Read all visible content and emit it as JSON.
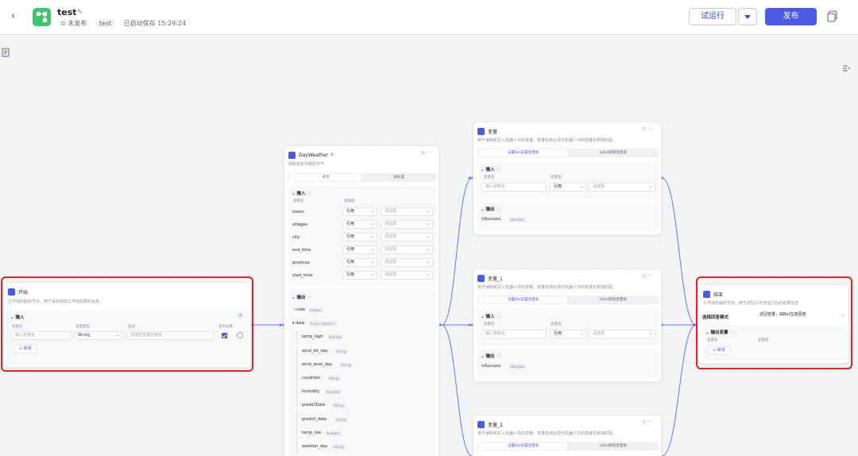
{
  "header": {
    "back_icon": "chevron-left-icon",
    "app_icon": "workflow-icon",
    "title": "test",
    "status": "⊙ 未发布",
    "tag": "test",
    "autosave": "已自动保存 15:29:24",
    "run_label": "试运行",
    "publish_label": "发布",
    "colors": {
      "primary": "#4b5ae4",
      "highlight": "#e02424",
      "app_icon": "#3ec46d"
    }
  },
  "start_node": {
    "title": "开始",
    "desc": "工作流的起始节点，用于设定启动工作流需要的信息",
    "input_title": "输入",
    "col_name": "变量名",
    "col_type": "变量类型",
    "col_desc": "描述",
    "col_required": "是否必要",
    "name_placeholder": "输入变量名",
    "type_value": "String",
    "desc_placeholder": "请描述变量的用途",
    "add_label": "+ 新增"
  },
  "weather_node": {
    "title": "DayWeather",
    "desc": "获取指定日期的天气",
    "tab1": "单次",
    "tab2": "批处理",
    "input_title": "输入",
    "col_name": "参数名",
    "col_value": "参数值",
    "params": [
      {
        "name": "towns",
        "mode": "引用",
        "value": "请选择"
      },
      {
        "name": "villages",
        "mode": "引用",
        "value": "请选择"
      },
      {
        "name": "city",
        "mode": "引用",
        "value": "请选择"
      },
      {
        "name": "end_time",
        "mode": "引用",
        "value": "请选择"
      },
      {
        "name": "province",
        "mode": "引用",
        "value": "请选择"
      },
      {
        "name": "start_time",
        "mode": "引用",
        "value": "请选择"
      }
    ],
    "output_title": "输出",
    "outputs": [
      {
        "name": "code",
        "type": "Integer"
      },
      {
        "name": "data",
        "type": "Array<Object>"
      },
      {
        "name": "temp_high",
        "type": "Number"
      },
      {
        "name": "wind_dir_day",
        "type": "String"
      },
      {
        "name": "wind_level_day",
        "type": "String"
      },
      {
        "name": "condition",
        "type": "String"
      },
      {
        "name": "humidity",
        "type": "Number"
      },
      {
        "name": "predictDate",
        "type": "String"
      },
      {
        "name": "predict_date",
        "type": "String"
      },
      {
        "name": "temp_low",
        "type": "Number"
      },
      {
        "name": "weather_day",
        "type": "String"
      }
    ]
  },
  "variable_nodes": [
    {
      "title": "变量",
      "desc": "用于读取和写入机器人中的变量。变量名称必须与机器人中的变量名称相匹配。",
      "tab1": "设置Bot设置变量值",
      "tab2": "从Bot获取变量值",
      "input_title": "输入",
      "col_name": "变量名",
      "col_value": "变量值",
      "name_placeholder": "输入参数名",
      "mode": "引用",
      "value": "请选择",
      "output_title": "输出",
      "out_name": "isSuccess",
      "out_type": "Boolean"
    },
    {
      "title": "变量_1",
      "desc": "用于读取和写入机器人中的变量。变量名称必须与机器人中的变量名称相匹配。",
      "tab1": "设置Bot设置变量值",
      "tab2": "从Bot获取变量值",
      "input_title": "输入",
      "col_name": "变量名",
      "col_value": "变量值",
      "name_placeholder": "输入参数名",
      "mode": "引用",
      "value": "请选择",
      "output_title": "输出",
      "out_name": "isSuccess",
      "out_type": "Boolean"
    },
    {
      "title": "变量_2",
      "desc": "用于读取和写入机器人中的变量。变量名称必须与机器人中的变量名称相匹配。",
      "tab1": "设置Bot设置变量值",
      "tab2": "从Bot获取变量值"
    }
  ],
  "end_node": {
    "title": "结束",
    "desc": "工作流的最终节点，用于返回工作流运行后的结果信息",
    "mode_label": "选择回答模式",
    "mode_value": "返回变量，由Bot生成回答",
    "output_title": "输出变量",
    "col_name": "变量名",
    "col_value": "变量值",
    "add_label": "+ 新增"
  }
}
